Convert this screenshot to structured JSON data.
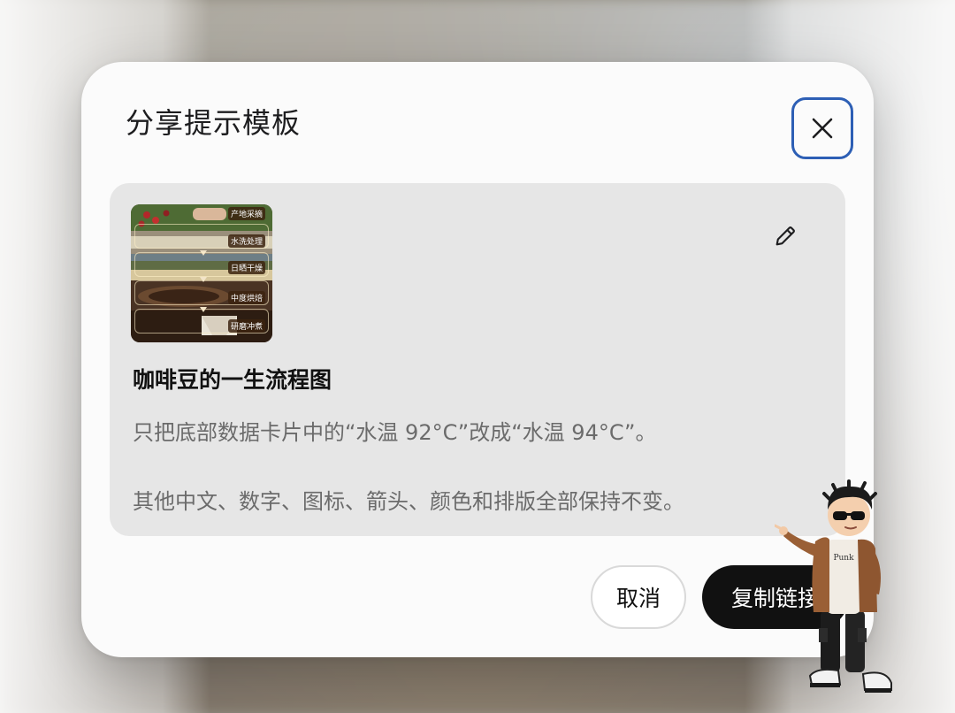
{
  "dialog": {
    "title": "分享提示模板",
    "close_icon": "close-icon"
  },
  "template_card": {
    "thumbnail": {
      "alt": "coffee-process-infographic",
      "steps": [
        "产地采摘",
        "水洗处理",
        "日晒干燥",
        "中度烘焙",
        "研磨冲煮"
      ]
    },
    "edit_icon": "pencil-icon",
    "title": "咖啡豆的一生流程图",
    "prompt_line_1": "只把底部数据卡片中的“水温 92°C”改成“水温 94°C”。",
    "prompt_line_2": "其他中文、数字、图标、箭头、颜色和排版全部保持不变。"
  },
  "actions": {
    "cancel_label": "取消",
    "copy_label": "复制链接"
  },
  "mascot": {
    "shirt_text": "Punk"
  },
  "colors": {
    "close_border": "#2d5fb5",
    "primary_button": "#111111",
    "card_bg": "#e6e6e6",
    "modal_bg": "#fbfbfb"
  }
}
